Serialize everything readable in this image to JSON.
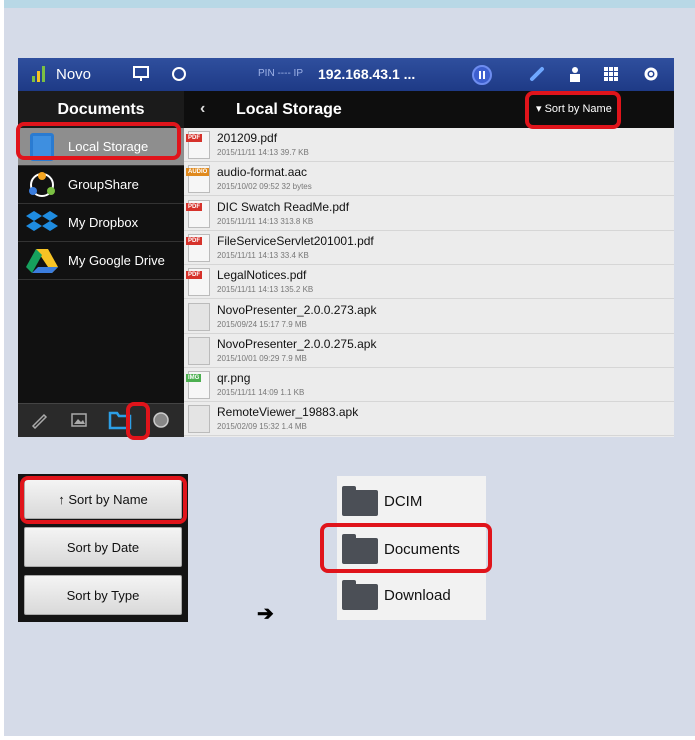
{
  "topbar": {
    "app_name": "Novo",
    "pin_label": "PIN ---- IP",
    "ip": "192.168.43.1",
    "ip_more": "..."
  },
  "left_panel": {
    "header": "Documents",
    "items": [
      {
        "label": "Local Storage",
        "icon": "tablet-icon"
      },
      {
        "label": "GroupShare",
        "icon": "groupshare-icon"
      },
      {
        "label": "My Dropbox",
        "icon": "dropbox-icon"
      },
      {
        "label": "My Google Drive",
        "icon": "google-drive-icon"
      }
    ],
    "bottom_icons": [
      "pen-icon",
      "image-icon",
      "folder-icon",
      "globe-icon"
    ]
  },
  "content": {
    "back": "‹",
    "title": "Local Storage",
    "sort_label": "▾ Sort by Name",
    "files": [
      {
        "name": "201209.pdf",
        "date": "2015/11/11 14:13",
        "size": "39.7 KB",
        "type": "PDF"
      },
      {
        "name": "audio-format.aac",
        "date": "2015/10/02 09:52",
        "size": "32 bytes",
        "type": "AUDIO"
      },
      {
        "name": "DIC Swatch ReadMe.pdf",
        "date": "2015/11/11 14:13",
        "size": "313.8 KB",
        "type": "PDF"
      },
      {
        "name": "FileServiceServlet201001.pdf",
        "date": "2015/11/11 14:13",
        "size": "33.4 KB",
        "type": "PDF"
      },
      {
        "name": "LegalNotices.pdf",
        "date": "2015/11/11 14:13",
        "size": "135.2 KB",
        "type": "PDF"
      },
      {
        "name": "NovoPresenter_2.0.0.273.apk",
        "date": "2015/09/24 15:17",
        "size": "7.9 MB",
        "type": ""
      },
      {
        "name": "NovoPresenter_2.0.0.275.apk",
        "date": "2015/10/01 09:29",
        "size": "7.9 MB",
        "type": ""
      },
      {
        "name": "qr.png",
        "date": "2015/11/11 14:09",
        "size": "1.1 KB",
        "type": "IMG"
      },
      {
        "name": "RemoteViewer_19883.apk",
        "date": "2015/02/09 15:32",
        "size": "1.4 MB",
        "type": ""
      }
    ]
  },
  "sort_menu": {
    "options": [
      "↑ Sort by Name",
      "Sort by Date",
      "Sort by Type"
    ]
  },
  "arrow": "➔",
  "folders": [
    "DCIM",
    "Documents",
    "Download"
  ],
  "colors": {
    "accent_red": "#e0141b",
    "topbar_blue": "#2f4f9e",
    "pdf_red": "#d6322b"
  }
}
